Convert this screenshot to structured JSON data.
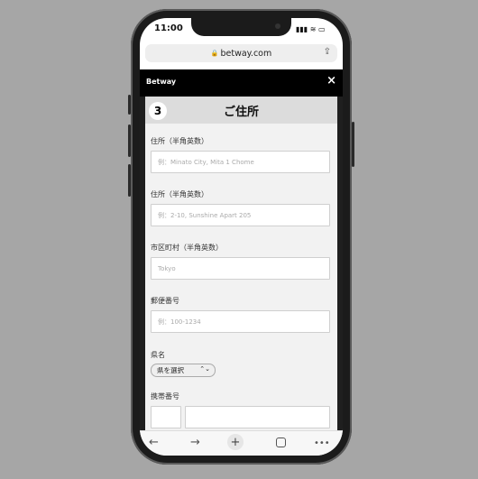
{
  "status": {
    "time": "11:00",
    "signal": "▮▮▮ ≋ ▭"
  },
  "browser": {
    "url": "betway.com"
  },
  "header": {
    "brand": "Betway",
    "close": "×"
  },
  "step": {
    "number": "3",
    "title": "ご住所"
  },
  "form": {
    "address1_label": "住所（半角英数）",
    "address1_placeholder": "例：Minato City, Mita 1 Chome",
    "address2_label": "住所（半角英数）",
    "address2_placeholder": "例：2-10, Sunshine Apart 205",
    "city_label": "市区町村（半角英数）",
    "city_placeholder": "Tokyo",
    "zip_label": "郵便番号",
    "zip_placeholder": "例：100-1234",
    "prefecture_label": "県名",
    "prefecture_value": "県を選択",
    "mobile_label": "携帯番号"
  },
  "bottom_bar": {
    "back": "←",
    "forward": "→",
    "new_tab": "+",
    "more": "•••"
  }
}
